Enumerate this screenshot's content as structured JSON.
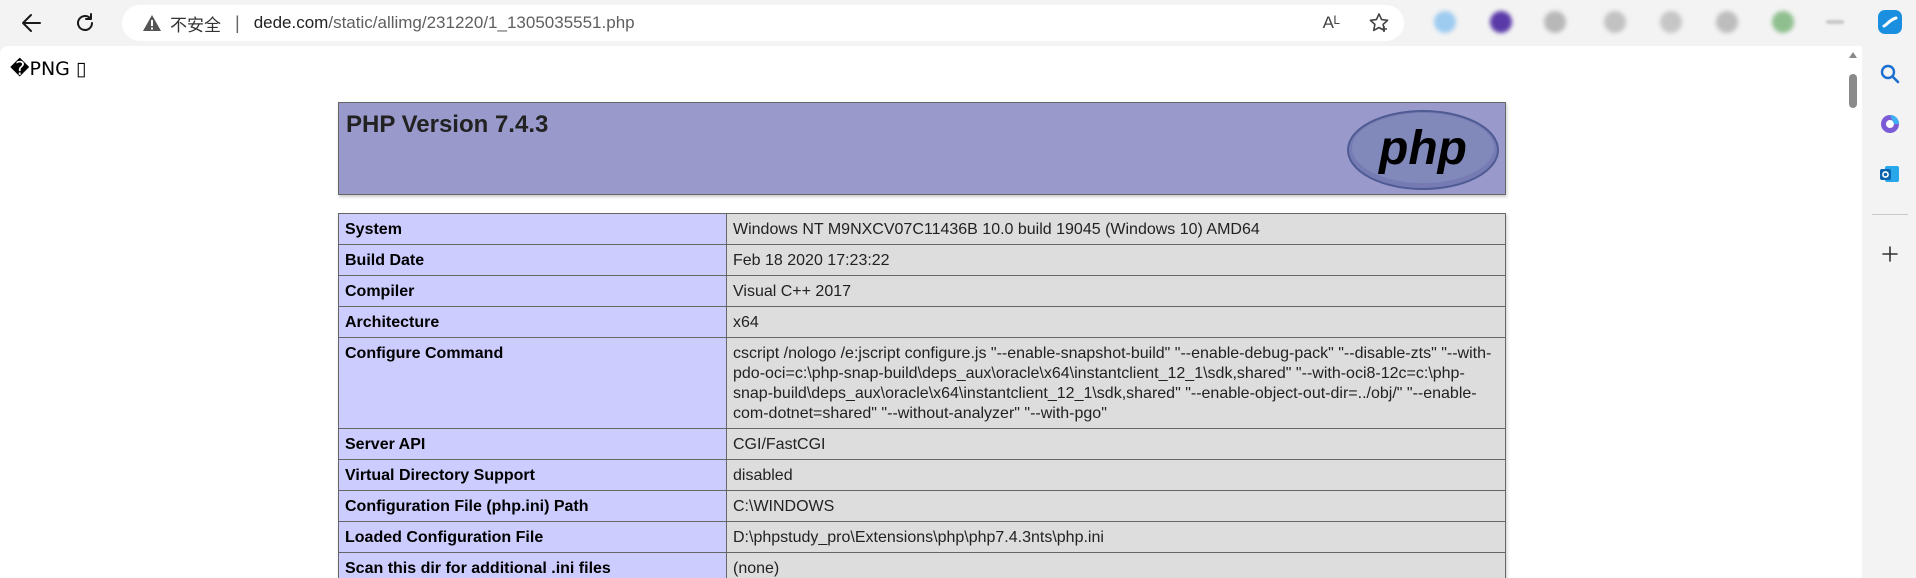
{
  "browser": {
    "address_insecure_label": "不安全",
    "address_separator": "|",
    "url_host": "dede.com",
    "url_path": "/static/allimg/231220/1_1305035551.php",
    "read_aloud_label": "Aᴸ"
  },
  "page": {
    "junk_text": "�PNG ▯",
    "title": "PHP Version 7.4.3",
    "logo_text": "php",
    "rows": [
      {
        "key": "System",
        "value": "Windows NT M9NXCV07C11436B 10.0 build 19045 (Windows 10) AMD64"
      },
      {
        "key": "Build Date",
        "value": "Feb 18 2020 17:23:22"
      },
      {
        "key": "Compiler",
        "value": "Visual C++ 2017"
      },
      {
        "key": "Architecture",
        "value": "x64"
      },
      {
        "key": "Configure Command",
        "value": "cscript /nologo /e:jscript configure.js \"--enable-snapshot-build\" \"--enable-debug-pack\" \"--disable-zts\" \"--with-pdo-oci=c:\\php-snap-build\\deps_aux\\oracle\\x64\\instantclient_12_1\\sdk,shared\" \"--with-oci8-12c=c:\\php-snap-build\\deps_aux\\oracle\\x64\\instantclient_12_1\\sdk,shared\" \"--enable-object-out-dir=../obj/\" \"--enable-com-dotnet=shared\" \"--without-analyzer\" \"--with-pgo\""
      },
      {
        "key": "Server API",
        "value": "CGI/FastCGI"
      },
      {
        "key": "Virtual Directory Support",
        "value": "disabled"
      },
      {
        "key": "Configuration File (php.ini) Path",
        "value": "C:\\WINDOWS"
      },
      {
        "key": "Loaded Configuration File",
        "value": "D:\\phpstudy_pro\\Extensions\\php\\php7.4.3nts\\php.ini"
      },
      {
        "key": "Scan this dir for additional .ini files",
        "value": "(none)"
      }
    ]
  },
  "colors": {
    "header_bg": "#9999cc",
    "key_cell_bg": "#ccccff",
    "value_cell_bg": "#dddddd",
    "logo_bg": "#777bb3"
  },
  "icons": [
    "back-icon",
    "refresh-icon",
    "warning-icon",
    "read-aloud-icon",
    "favorite-star-icon",
    "search-icon",
    "copilot-icon",
    "outlook-icon",
    "add-icon"
  ]
}
